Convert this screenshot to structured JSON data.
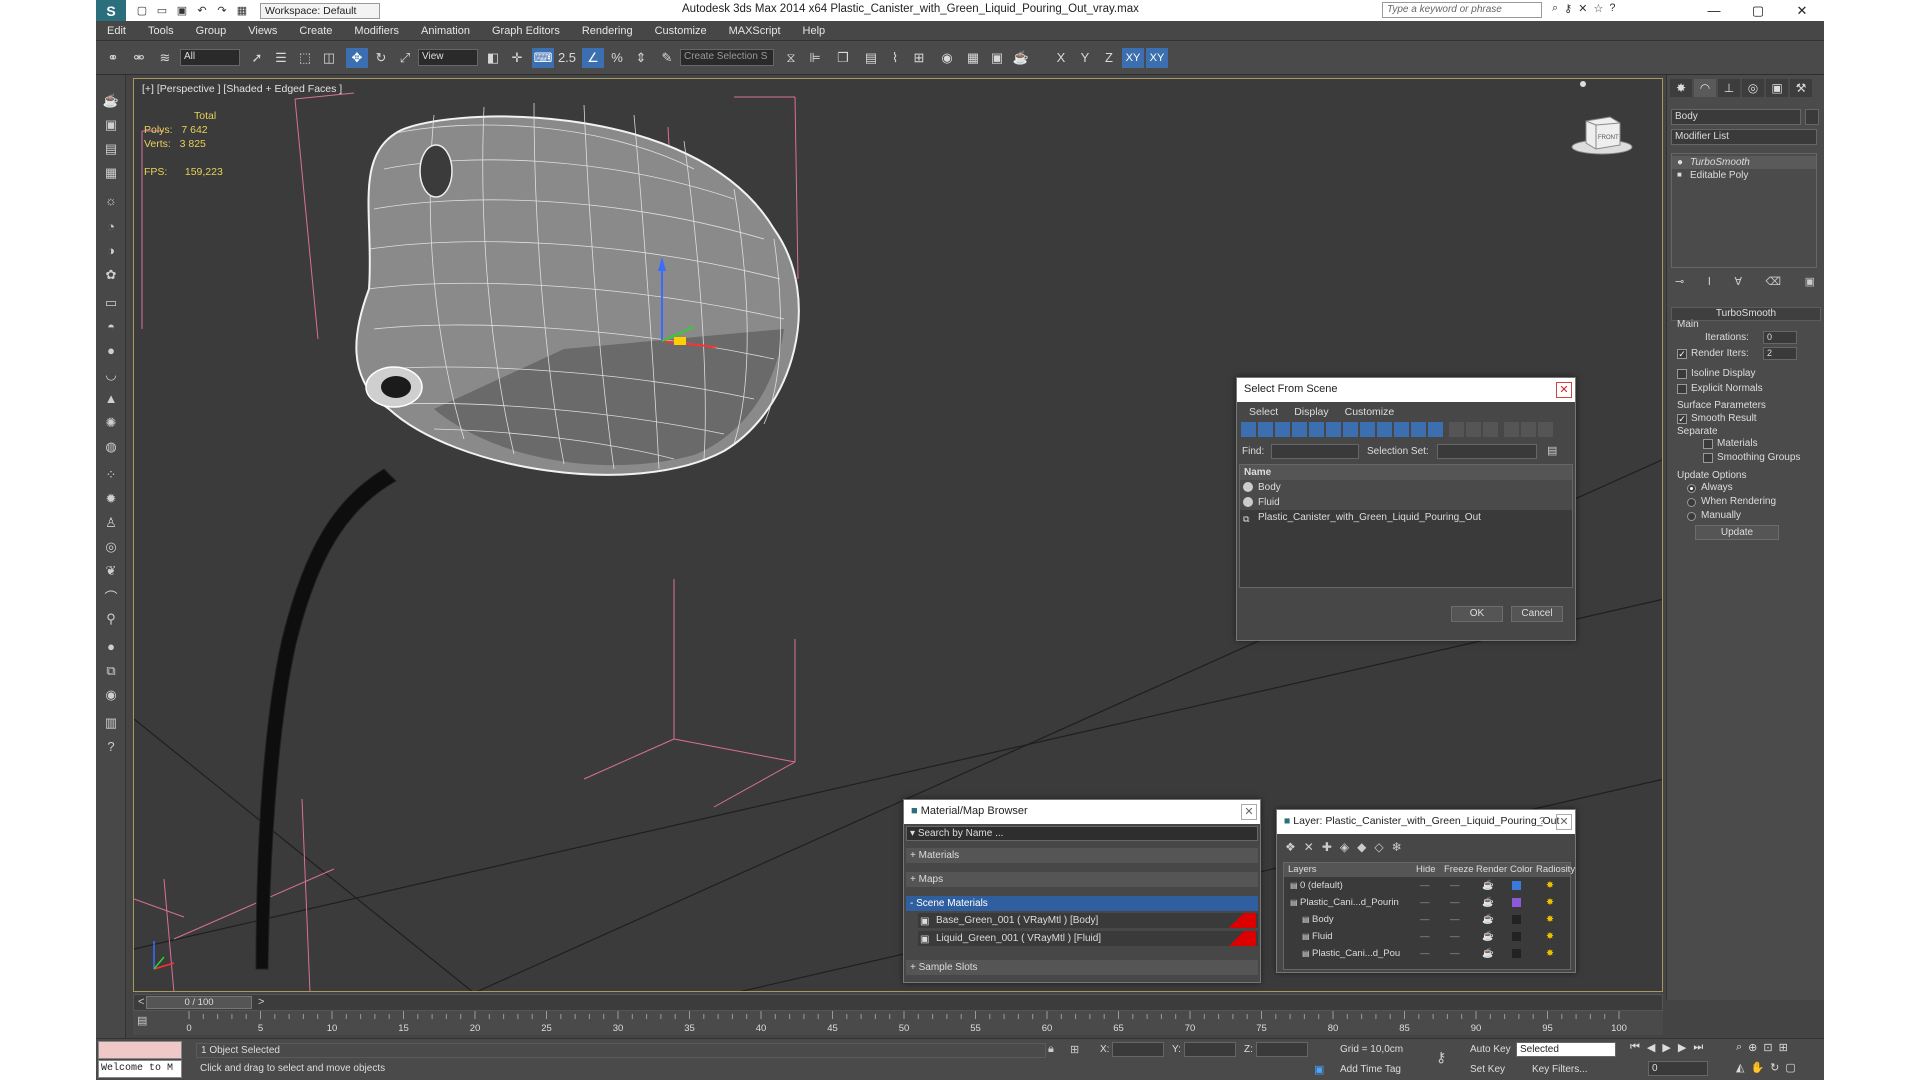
{
  "titlebar": {
    "workspace": "Workspace: Default",
    "title": "Autodesk 3ds Max  2014 x64     Plastic_Canister_with_Green_Liquid_Pouring_Out_vray.max",
    "search_placeholder": "Type a keyword or phrase"
  },
  "menu": [
    "Edit",
    "Tools",
    "Group",
    "Views",
    "Create",
    "Modifiers",
    "Animation",
    "Graph Editors",
    "Rendering",
    "Customize",
    "MAXScript",
    "Help"
  ],
  "toolbar": {
    "filter": "All",
    "refcoord": "View",
    "selset_placeholder": "Create Selection S",
    "snap_angle": "2.5",
    "axes": [
      "X",
      "Y",
      "Z",
      "XY",
      "XY"
    ]
  },
  "viewport": {
    "label": "[+] [Perspective ] [Shaded + Edged Faces ]",
    "stats": {
      "total_label": "Total",
      "polys_label": "Polys:",
      "polys": "7 642",
      "verts_label": "Verts:",
      "verts": "3 825",
      "fps_label": "FPS:",
      "fps": "159,223"
    },
    "viewcube_label": "FRONT"
  },
  "cmdpanel": {
    "object_name": "Body",
    "modifier_list": "Modifier List",
    "stack": [
      "TurboSmooth",
      "Editable Poly"
    ],
    "rollout_title": "TurboSmooth",
    "main_label": "Main",
    "iterations_label": "Iterations:",
    "iterations": "0",
    "render_iters_label": "Render Iters:",
    "render_iters": "2",
    "isoline": "Isoline Display",
    "explicit_normals": "Explicit Normals",
    "surface_params": "Surface Parameters",
    "smooth_result": "Smooth Result",
    "separate": "Separate",
    "materials": "Materials",
    "smoothing_groups": "Smoothing Groups",
    "update_options": "Update Options",
    "always": "Always",
    "when_rendering": "When Rendering",
    "manually": "Manually",
    "update_button": "Update"
  },
  "select_dialog": {
    "title": "Select From Scene",
    "menu": [
      "Select",
      "Display",
      "Customize"
    ],
    "find_label": "Find:",
    "selection_set_label": "Selection Set:",
    "column": "Name",
    "items": [
      "Body",
      "Fluid",
      "Plastic_Canister_with_Green_Liquid_Pouring_Out"
    ],
    "ok": "OK",
    "cancel": "Cancel"
  },
  "material_browser": {
    "title": "Material/Map Browser",
    "search": "Search by Name ...",
    "sections": [
      "+ Materials",
      "+ Maps",
      "- Scene Materials",
      "+ Sample Slots"
    ],
    "materials": [
      "Base_Green_001  ( VRayMtl )  [Body]",
      "Liquid_Green_001  ( VRayMtl )  [Fluid]"
    ]
  },
  "layer_dialog": {
    "title": "Layer: Plastic_Canister_with_Green_Liquid_Pouring_Out",
    "columns": [
      "Layers",
      "Hide",
      "Freeze",
      "Render",
      "Color",
      "Radiosity"
    ],
    "rows": [
      {
        "name": "0 (default)",
        "color": "#3a7ad8"
      },
      {
        "name": "Plastic_Cani...d_Pourin",
        "color": "#8a5ad8"
      },
      {
        "name": "Body",
        "color": "#222222"
      },
      {
        "name": "Fluid",
        "color": "#222222"
      },
      {
        "name": "Plastic_Cani...d_Pou",
        "color": "#222222"
      }
    ]
  },
  "timeline": {
    "frame": "0 / 100",
    "ticks": [
      "0",
      "5",
      "10",
      "15",
      "20",
      "25",
      "30",
      "35",
      "40",
      "45",
      "50",
      "55",
      "60",
      "65",
      "70",
      "75",
      "80",
      "85",
      "90",
      "95",
      "100"
    ]
  },
  "status": {
    "listener": "Welcome to M",
    "selected": "1 Object Selected",
    "prompt": "Click and drag to select and move objects",
    "x_label": "X:",
    "y_label": "Y:",
    "z_label": "Z:",
    "grid": "Grid = 10,0cm",
    "add_time_tag": "Add Time Tag",
    "auto_key": "Auto Key",
    "set_key": "Set Key",
    "selected_dropdown": "Selected",
    "key_filters": "Key Filters...",
    "frame_field": "0"
  }
}
